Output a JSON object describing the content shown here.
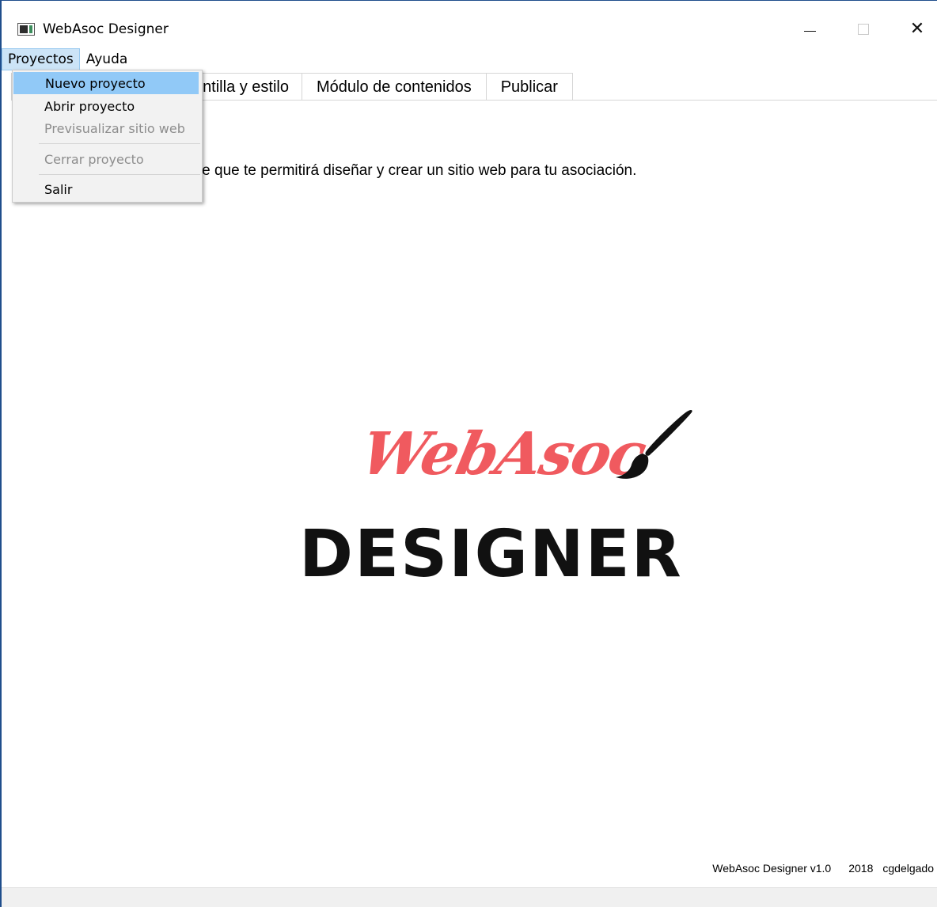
{
  "window": {
    "title": "WebAsoc Designer"
  },
  "menubar": {
    "items": [
      {
        "label": "Proyectos"
      },
      {
        "label": "Ayuda"
      }
    ]
  },
  "dropdown": {
    "items": [
      {
        "label": "Nuevo proyecto",
        "enabled": true,
        "highlighted": true
      },
      {
        "label": "Abrir proyecto",
        "enabled": true
      },
      {
        "label": "Previsualizar sitio web",
        "enabled": false
      },
      {
        "label": "Cerrar proyecto",
        "enabled": false
      },
      {
        "label": "Salir",
        "enabled": true
      }
    ]
  },
  "tabs": [
    {
      "label": "ntilla y estilo"
    },
    {
      "label": "Módulo de contenidos"
    },
    {
      "label": "Publicar"
    }
  ],
  "main": {
    "welcome_text": "bAsoc Designer, el asistente que te permitirá diseñar y crear un sitio web para tu asociación."
  },
  "logo": {
    "script_text": "WebAsoc",
    "main_text": "DESIGNER",
    "script_color": "#f05a5f",
    "main_color": "#111111"
  },
  "footer": {
    "app_version": "WebAsoc Designer v1.0",
    "year": "2018",
    "author": "cgdelgado"
  }
}
